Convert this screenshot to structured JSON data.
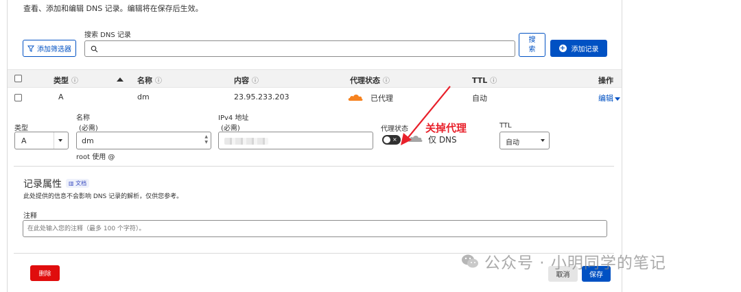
{
  "description": "查看、添加和编辑 DNS 记录。编辑将在保存后生效。",
  "toolbar": {
    "filter_label": "添加筛选器",
    "search_label": "搜索 DNS 记录",
    "search_placeholder": "",
    "search_button": "搜索",
    "add_record": "添加记录"
  },
  "table": {
    "headers": {
      "type": "类型",
      "name": "名称",
      "content": "内容",
      "proxy": "代理状态",
      "ttl": "TTL",
      "actions": "操作"
    },
    "info_glyph": "ⓘ",
    "row": {
      "type": "A",
      "name": "dm",
      "content": "23.95.233.203",
      "proxy": "已代理",
      "ttl": "自动",
      "edit": "编辑"
    }
  },
  "edit_form": {
    "type_label": "类型",
    "type_value": "A",
    "name_label": "名称",
    "name_required": "(必需)",
    "name_value": "dm",
    "name_hint": "root 使用 @",
    "ipv4_label": "IPv4 地址",
    "ipv4_required": "(必需)",
    "proxy_label": "代理状态",
    "proxy_value": "仅 DNS",
    "proxy_enabled": false,
    "ttl_label": "TTL",
    "ttl_value": "自动"
  },
  "annotation": {
    "text": "关掉代理",
    "color": "#e8202a"
  },
  "record_attributes": {
    "title": "记录属性",
    "doc_badge": "文档",
    "description": "此处提供的信息不会影响 DNS 记录的解析，仅供您参考。",
    "comment_label": "注释",
    "comment_placeholder": "在此处输入您的注释（最多 100 个字符）。"
  },
  "actions": {
    "delete": "删除",
    "cancel": "取消",
    "save": "保存"
  },
  "watermark": {
    "text": "公众号 · 小明同学的笔记",
    "icon": "wechat-icon"
  },
  "colors": {
    "primary": "#0051c3",
    "danger": "#e00d0d",
    "proxied_cloud": "#f6821f",
    "annotation": "#e8202a"
  }
}
